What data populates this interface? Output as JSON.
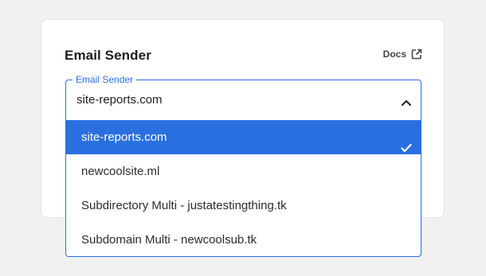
{
  "card": {
    "title": "Email Sender",
    "docs_label": "Docs"
  },
  "select": {
    "legend": "Email Sender",
    "value": "site-reports.com"
  },
  "options": [
    {
      "label": "site-reports.com",
      "selected": true
    },
    {
      "label": "newcoolsite.ml",
      "selected": false
    },
    {
      "label": "Subdirectory Multi - justatestingthing.tk",
      "selected": false
    },
    {
      "label": "Subdomain Multi - newcoolsub.tk",
      "selected": false
    }
  ],
  "colors": {
    "accent": "#2a6fe0",
    "background": "#f1f1f1",
    "card": "#ffffff"
  },
  "icons": {
    "docs": "external-link-icon",
    "select": "chevron-up-icon",
    "selected": "checkmark-icon"
  }
}
